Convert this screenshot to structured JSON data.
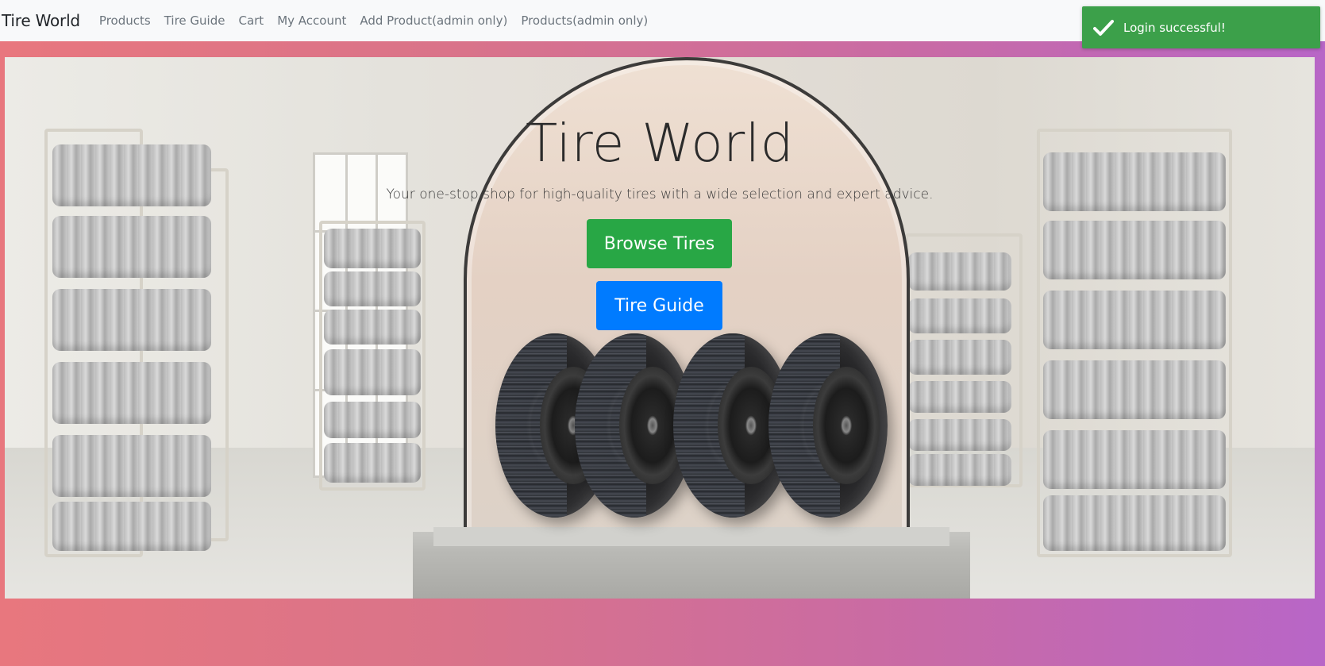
{
  "navbar": {
    "brand": "Tire World",
    "links": [
      "Products",
      "Tire Guide",
      "Cart",
      "My Account",
      "Add Product(admin only)",
      "Products(admin only)"
    ]
  },
  "toast": {
    "message": "Login successful!",
    "icon": "checkmark-icon",
    "color": "#3ca04a"
  },
  "hero": {
    "title": "Tire World",
    "subtitle": "Your one-stop shop for high-quality tires with a wide selection and expert advice.",
    "browse_button": "Browse Tires",
    "guide_button": "Tire Guide",
    "browse_color": "#28a745",
    "guide_color": "#007bff"
  }
}
